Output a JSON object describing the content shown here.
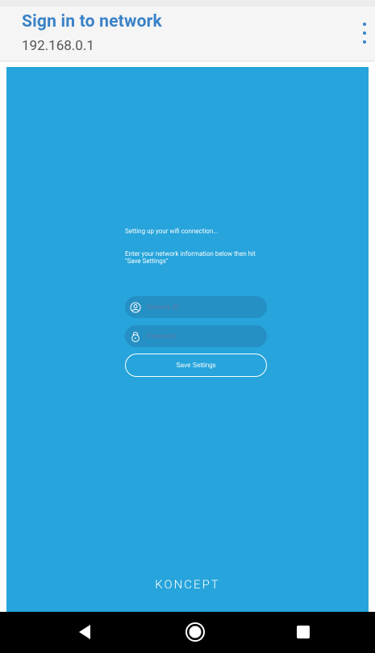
{
  "app_bar": {
    "title": "Sign in to network",
    "subtitle": "192.168.0.1",
    "menu_icon": "overflow-menu-icon",
    "title_color": "#3a82c8"
  },
  "page": {
    "background_color": "#26a4db",
    "status_message": "Setting up your wifi connection...",
    "instructions": "Enter your network information below then hit \"Save Settings\"",
    "ssid_field": {
      "placeholder": "Network ID",
      "value": "",
      "icon": "user-icon"
    },
    "password_field": {
      "placeholder": "Password",
      "value": "",
      "icon": "lock-icon"
    },
    "save_button_label": "Save Settings",
    "brand": "KONCEPT"
  },
  "nav_bar": {
    "back_icon": "back-icon",
    "home_icon": "home-icon",
    "recents_icon": "recents-icon"
  }
}
